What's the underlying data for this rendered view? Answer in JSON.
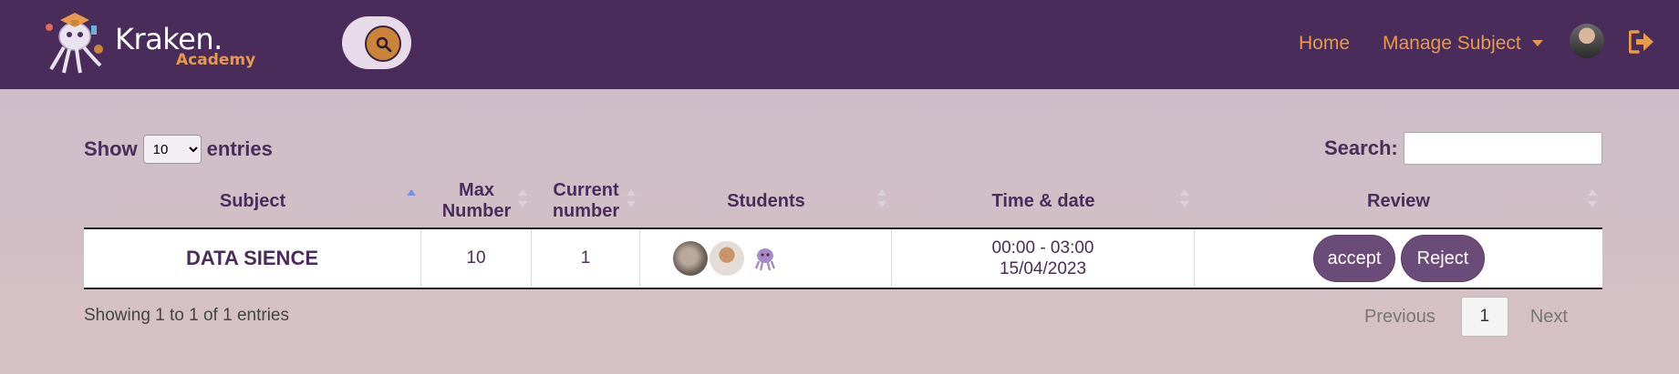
{
  "brand": {
    "name": "Kraken.",
    "subtitle": "Academy",
    "logo_icon": "octopus-graduate-logo"
  },
  "header": {
    "search_icon": "search-icon",
    "nav": [
      {
        "label": "Home"
      },
      {
        "label": "Manage Subject",
        "icon": "caret-down-icon"
      }
    ],
    "avatar_icon": "user-avatar",
    "logout_icon": "sign-out-icon"
  },
  "controls": {
    "show_label": "Show",
    "entries_label": "entries",
    "page_length": "10",
    "search_label": "Search:",
    "search_value": ""
  },
  "table": {
    "columns": [
      "Subject",
      "Max Number",
      "Current number",
      "Students",
      "Time & date",
      "Review"
    ],
    "sorted_column": "Subject",
    "rows": [
      {
        "subject": "DATA SIENCE",
        "max_number": "10",
        "current_number": "1",
        "students": [
          "student-avatar-1",
          "student-avatar-2",
          "octopus-avatar"
        ],
        "time": "00:00 - 03:00",
        "date": "15/04/2023",
        "actions": {
          "accept": "accept",
          "reject": "Reject"
        }
      }
    ]
  },
  "footer": {
    "info": "Showing 1 to 1 of 1 entries",
    "previous": "Previous",
    "page": "1",
    "next": "Next"
  },
  "colors": {
    "navbar": "#4a2c5a",
    "accent": "#e69a4a",
    "button": "#6b4b78"
  }
}
